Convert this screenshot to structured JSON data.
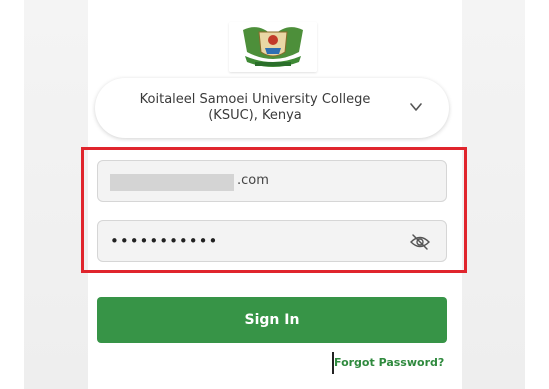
{
  "college": {
    "selected": "Koitaleel Samoei University College (KSUC), Kenya",
    "logo_icon": "university-crest-icon"
  },
  "login": {
    "email_visible_suffix": ".com",
    "password_masked": "•••••••••••",
    "eye_icon": "eye-slash-icon",
    "signin_label": "Sign In",
    "forgot_label": "Forgot Password?"
  },
  "colors": {
    "primary_green": "#379447",
    "link_green": "#2f8a3e",
    "highlight_red": "#e0252d"
  }
}
